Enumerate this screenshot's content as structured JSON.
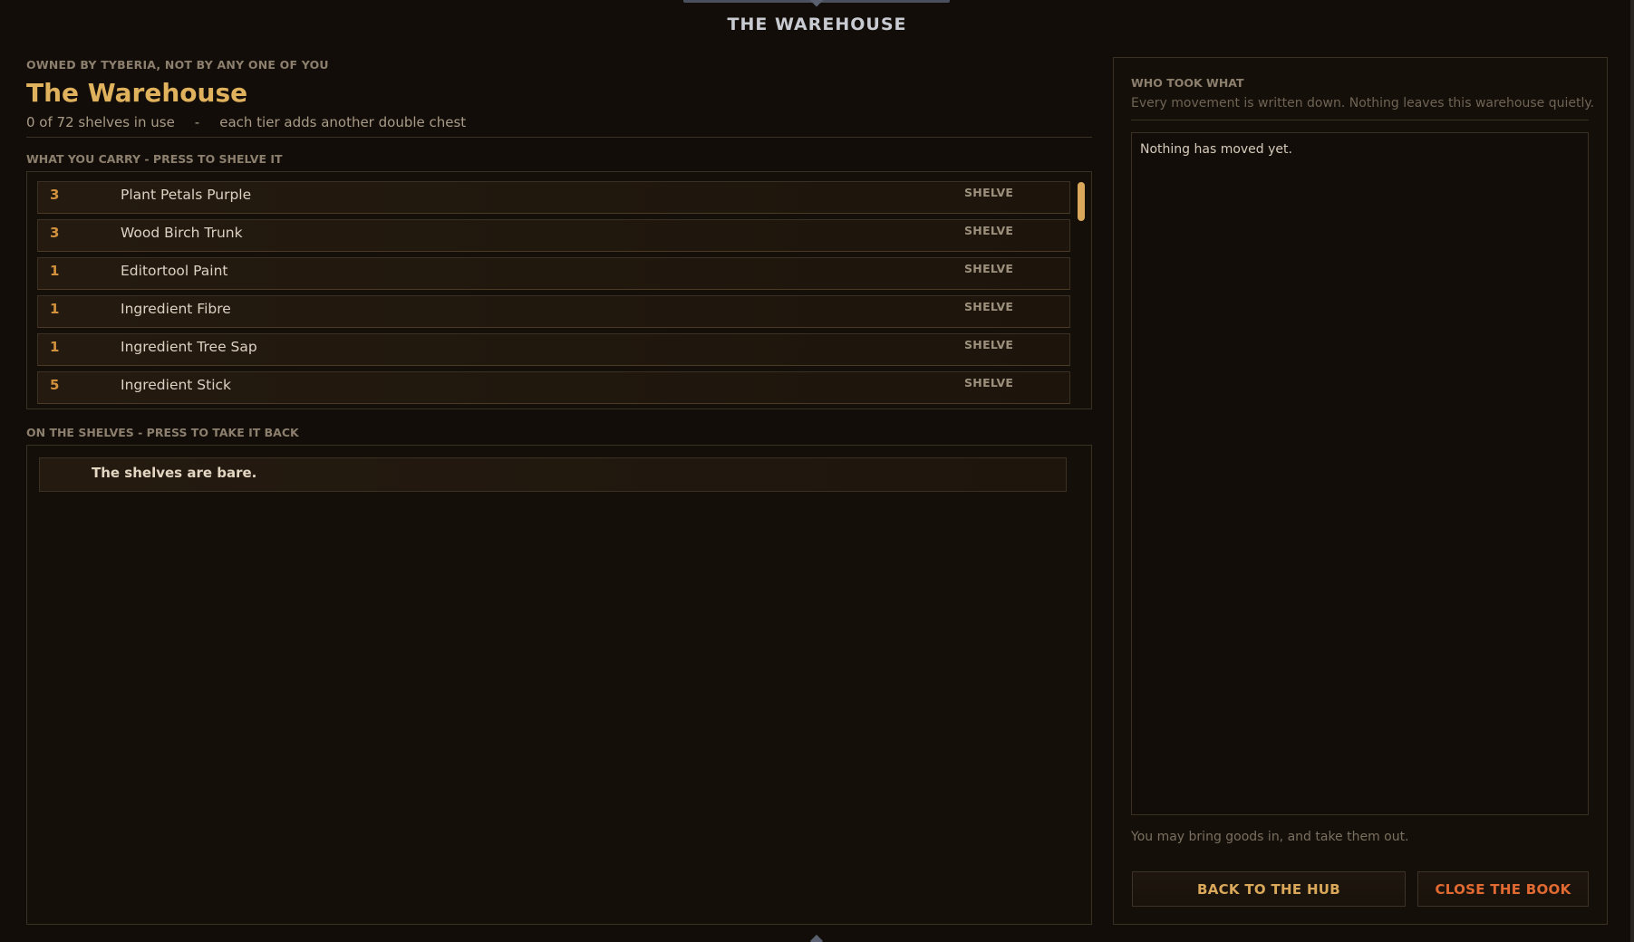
{
  "window": {
    "title": "THE WAREHOUSE"
  },
  "header": {
    "owner_line": "OWNED BY TYBERIA, NOT BY ANY ONE OF YOU",
    "title": "The Warehouse",
    "capacity": "0 of 72 shelves in use",
    "separator": "-",
    "tier_note": "each tier adds another double chest"
  },
  "carry": {
    "label": "WHAT YOU CARRY - PRESS TO SHELVE IT",
    "action_label": "SHELVE",
    "items": [
      {
        "qty": "3",
        "name": "Plant Petals Purple"
      },
      {
        "qty": "3",
        "name": "Wood Birch Trunk"
      },
      {
        "qty": "1",
        "name": "Editortool Paint"
      },
      {
        "qty": "1",
        "name": "Ingredient Fibre"
      },
      {
        "qty": "1",
        "name": "Ingredient Tree Sap"
      },
      {
        "qty": "5",
        "name": "Ingredient Stick"
      }
    ]
  },
  "shelves": {
    "label": "ON THE SHELVES - PRESS TO TAKE IT BACK",
    "empty_text": "The shelves are bare."
  },
  "log": {
    "title": "WHO TOOK WHAT",
    "subtitle": "Every movement is written down. Nothing leaves this warehouse quietly.",
    "empty_text": "Nothing has moved yet.",
    "permission": "You may bring goods in, and take them out."
  },
  "buttons": {
    "hub": "BACK TO THE HUB",
    "close": "CLOSE THE BOOK"
  },
  "colors": {
    "accent_gold": "#e0b25d",
    "quantity_orange": "#d2913c",
    "close_red": "#e06a32",
    "background": "#120d08"
  }
}
